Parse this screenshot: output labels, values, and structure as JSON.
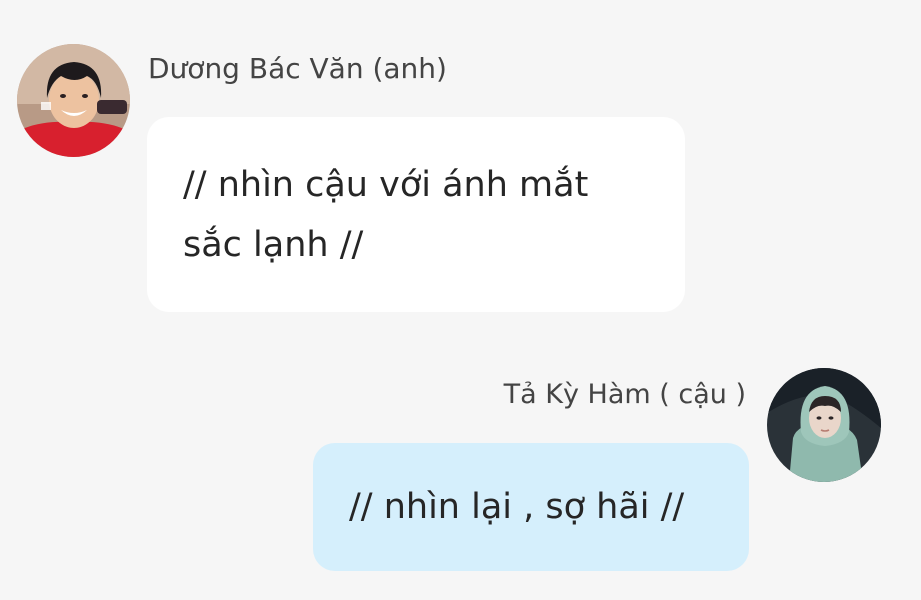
{
  "messages": [
    {
      "sender": "Dương Bác Văn (anh)",
      "text": "// nhìn cậu với ánh mắt sắc lạnh //",
      "align": "left",
      "bubble_color": "#ffffff",
      "avatar": "boy-red-shirt-avatar"
    },
    {
      "sender": "Tả Kỳ Hàm ( cậu )",
      "text": "// nhìn lại , sợ hãi //",
      "align": "right",
      "bubble_color": "#d5effc",
      "avatar": "boy-green-hoodie-avatar"
    }
  ],
  "colors": {
    "background": "#f6f6f6",
    "sender_name": "#444444",
    "message_text": "#262626"
  }
}
